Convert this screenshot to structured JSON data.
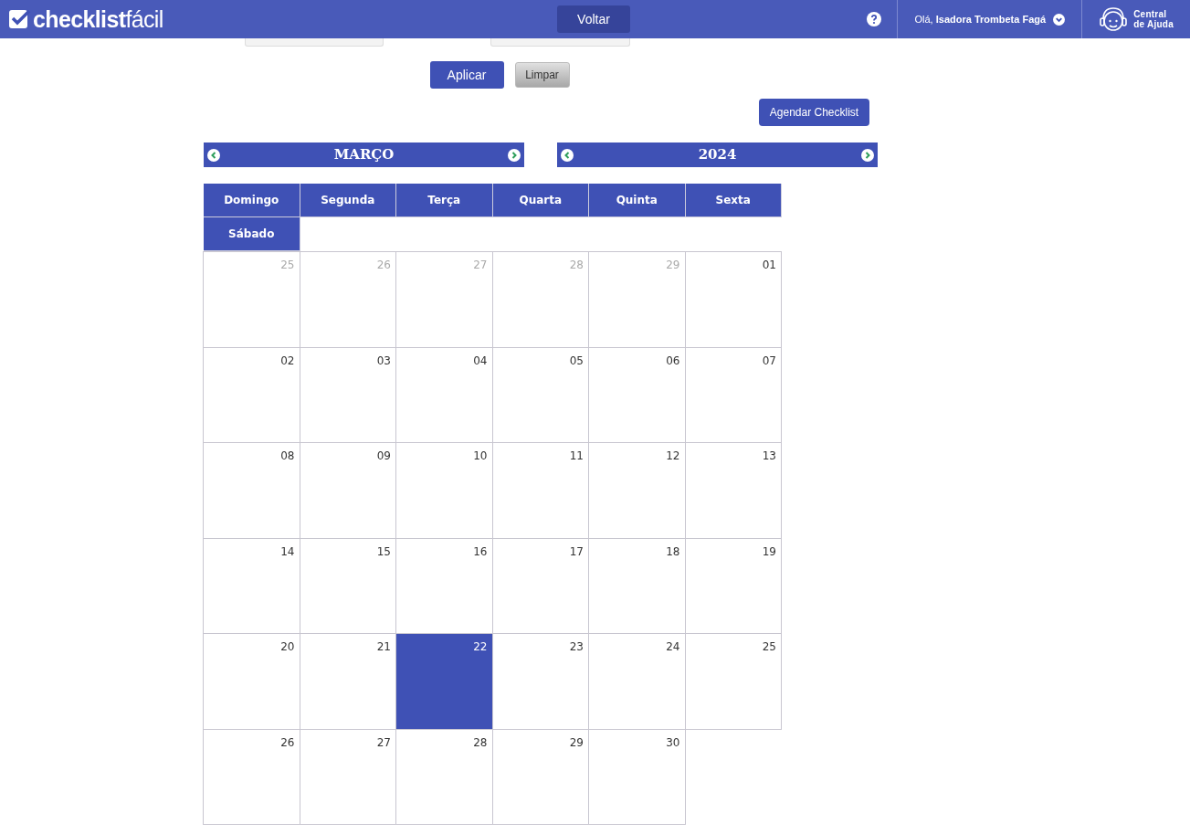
{
  "header": {
    "logo_bold": "checklist",
    "logo_light": "fácil",
    "greeting": "Olá,",
    "user_name": "Isadora Trombeta Fagá",
    "help_center": [
      "Central",
      "de Ajuda"
    ]
  },
  "back_button": "Voltar",
  "apply_button": "Aplicar",
  "clear_button": "Limpar",
  "schedule_button": "Agendar Checklist",
  "month": "MARÇO",
  "year": "2024",
  "weekdays": [
    "Domingo",
    "Segunda",
    "Terça",
    "Quarta",
    "Quinta",
    "Sexta",
    "Sábado"
  ],
  "days": [
    {
      "label": "25",
      "muted": true,
      "selected": false
    },
    {
      "label": "26",
      "muted": true,
      "selected": false
    },
    {
      "label": "27",
      "muted": true,
      "selected": false
    },
    {
      "label": "28",
      "muted": true,
      "selected": false
    },
    {
      "label": "29",
      "muted": true,
      "selected": false
    },
    {
      "label": "01",
      "muted": false,
      "selected": false
    },
    {
      "label": "02",
      "muted": false,
      "selected": false
    },
    {
      "label": "03",
      "muted": false,
      "selected": false
    },
    {
      "label": "04",
      "muted": false,
      "selected": false
    },
    {
      "label": "05",
      "muted": false,
      "selected": false
    },
    {
      "label": "06",
      "muted": false,
      "selected": false
    },
    {
      "label": "07",
      "muted": false,
      "selected": false
    },
    {
      "label": "08",
      "muted": false,
      "selected": false
    },
    {
      "label": "09",
      "muted": false,
      "selected": false
    },
    {
      "label": "10",
      "muted": false,
      "selected": false
    },
    {
      "label": "11",
      "muted": false,
      "selected": false
    },
    {
      "label": "12",
      "muted": false,
      "selected": false
    },
    {
      "label": "13",
      "muted": false,
      "selected": false
    },
    {
      "label": "14",
      "muted": false,
      "selected": false
    },
    {
      "label": "15",
      "muted": false,
      "selected": false
    },
    {
      "label": "16",
      "muted": false,
      "selected": false
    },
    {
      "label": "17",
      "muted": false,
      "selected": false
    },
    {
      "label": "18",
      "muted": false,
      "selected": false
    },
    {
      "label": "19",
      "muted": false,
      "selected": false
    },
    {
      "label": "20",
      "muted": false,
      "selected": false
    },
    {
      "label": "21",
      "muted": false,
      "selected": false
    },
    {
      "label": "22",
      "muted": false,
      "selected": true
    },
    {
      "label": "23",
      "muted": false,
      "selected": false
    },
    {
      "label": "24",
      "muted": false,
      "selected": false
    },
    {
      "label": "25",
      "muted": false,
      "selected": false
    },
    {
      "label": "26",
      "muted": false,
      "selected": false
    },
    {
      "label": "27",
      "muted": false,
      "selected": false
    },
    {
      "label": "28",
      "muted": false,
      "selected": false
    },
    {
      "label": "29",
      "muted": false,
      "selected": false
    },
    {
      "label": "30",
      "muted": false,
      "selected": false
    }
  ]
}
